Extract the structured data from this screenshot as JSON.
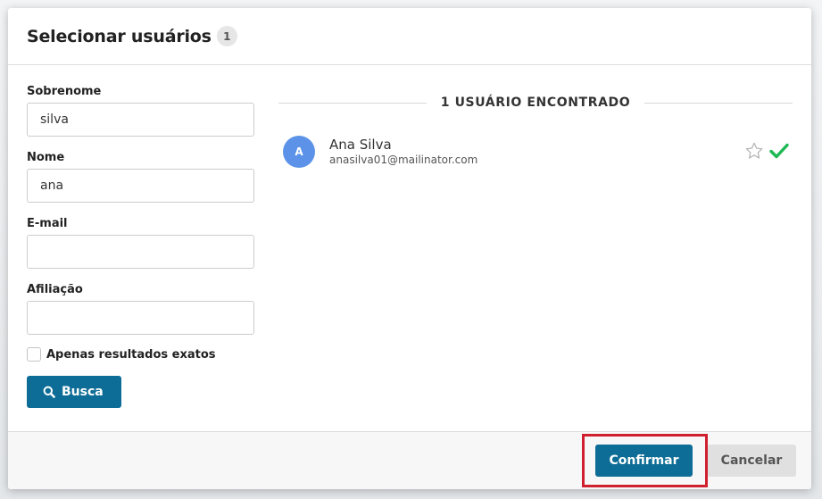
{
  "modal": {
    "title": "Selecionar usuários",
    "count": "1"
  },
  "form": {
    "surname_label": "Sobrenome",
    "surname_value": "silva",
    "name_label": "Nome",
    "name_value": "ana",
    "email_label": "E-mail",
    "email_value": "",
    "affiliation_label": "Afiliação",
    "affiliation_value": "",
    "exact_results_label": "Apenas resultados exatos",
    "exact_results_checked": false,
    "search_button": "Busca"
  },
  "results": {
    "header": "1 USUÁRIO ENCONTRADO",
    "users": [
      {
        "initial": "A",
        "name": "Ana Silva",
        "email": "anasilva01@mailinator.com",
        "avatar_color": "#5c93e8",
        "favorite_icon": "star-outline-icon",
        "selected_icon": "checkmark-icon"
      }
    ]
  },
  "footer": {
    "confirm_label": "Confirmar",
    "cancel_label": "Cancelar"
  },
  "colors": {
    "primary": "#0e6d96",
    "check": "#1db954",
    "highlight": "#d0202f"
  }
}
